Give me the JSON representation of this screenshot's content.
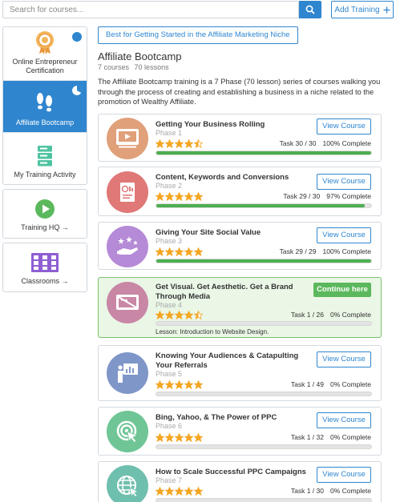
{
  "search": {
    "placeholder": "Search for courses..."
  },
  "header": {
    "add_training_label": "Add Training",
    "add_icon": "plus-icon"
  },
  "sidebar": {
    "items": [
      {
        "label": "Online Entrepreneur Certification",
        "icon": "certificate-icon",
        "badge_color": "#2f86cf"
      },
      {
        "label": "Affiliate Bootcamp",
        "icon": "footprints-icon",
        "badge_color": "#ffffff",
        "active": true
      },
      {
        "label": "My Training Activity",
        "icon": "server-stack-icon"
      }
    ],
    "training_hq": {
      "label": "Training HQ →",
      "icon": "play-circle-icon"
    },
    "classrooms": {
      "label": "Classrooms →",
      "icon": "classroom-grid-icon"
    }
  },
  "main": {
    "niche_button": "Best for Getting Started in the Affiliate Marketing Niche",
    "title": "Affiliate Bootcamp",
    "courses_count": "7 courses",
    "lessons_count": "70 lessons",
    "description": "The Affiliate Bootcamp training is a 7 Phase (70 lesson) series of courses walking you through the process of creating and establishing a business in a niche related to the promotion of Wealthy Affiliate."
  },
  "colors": {
    "accent": "#2f86cf",
    "progress": "#4caf50",
    "star": "#f4a623",
    "continue": "#5cb85c"
  },
  "courses": [
    {
      "title": "Getting Your Business Rolling",
      "phase": "Phase 1",
      "rating": 4.5,
      "task": "Task 30 / 30",
      "complete": "100% Complete",
      "progress": 1.0,
      "button": "View Course",
      "icon": "video-player-icon",
      "color": "#e0a07a"
    },
    {
      "title": "Content, Keywords and Conversions",
      "phase": "Phase 2",
      "rating": 5,
      "task": "Task 29 / 30",
      "complete": "97% Complete",
      "progress": 0.97,
      "button": "View Course",
      "icon": "document-chart-icon",
      "color": "#e07878"
    },
    {
      "title": "Giving Your Site Social Value",
      "phase": "Phase 3",
      "rating": 5,
      "task": "Task 29 / 29",
      "complete": "100% Complete",
      "progress": 1.0,
      "button": "View Course",
      "icon": "hand-stars-icon",
      "color": "#b58ad6"
    },
    {
      "title": "Get Visual. Get Aesthetic. Get a Brand Through Media",
      "phase": "Phase 4",
      "rating": 4.5,
      "task": "Task 1 / 26",
      "complete": "0% Complete",
      "progress": 0,
      "button": "Continue here",
      "lesson": "Lesson: Introduction to Website Design.",
      "icon": "credit-card-icon",
      "color": "#c987a6",
      "current": true
    },
    {
      "title": "Knowing Your Audiences & Catapulting Your Referrals",
      "phase": "Phase 5",
      "rating": 5,
      "task": "Task 1 / 49",
      "complete": "0% Complete",
      "progress": 0,
      "button": "View Course",
      "icon": "presentation-icon",
      "color": "#7f96c8"
    },
    {
      "title": "Bing, Yahoo, & The Power of PPC",
      "phase": "Phase 6",
      "rating": 5,
      "task": "Task 1 / 32",
      "complete": "0% Complete",
      "progress": 0,
      "button": "View Course",
      "icon": "target-click-icon",
      "color": "#6fc596"
    },
    {
      "title": "How to Scale Successful PPC Campaigns",
      "phase": "Phase 7",
      "rating": 5,
      "task": "Task 1 / 30",
      "complete": "0% Complete",
      "progress": 0,
      "button": "View Course",
      "icon": "globe-cursor-icon",
      "color": "#6fbfae"
    }
  ]
}
